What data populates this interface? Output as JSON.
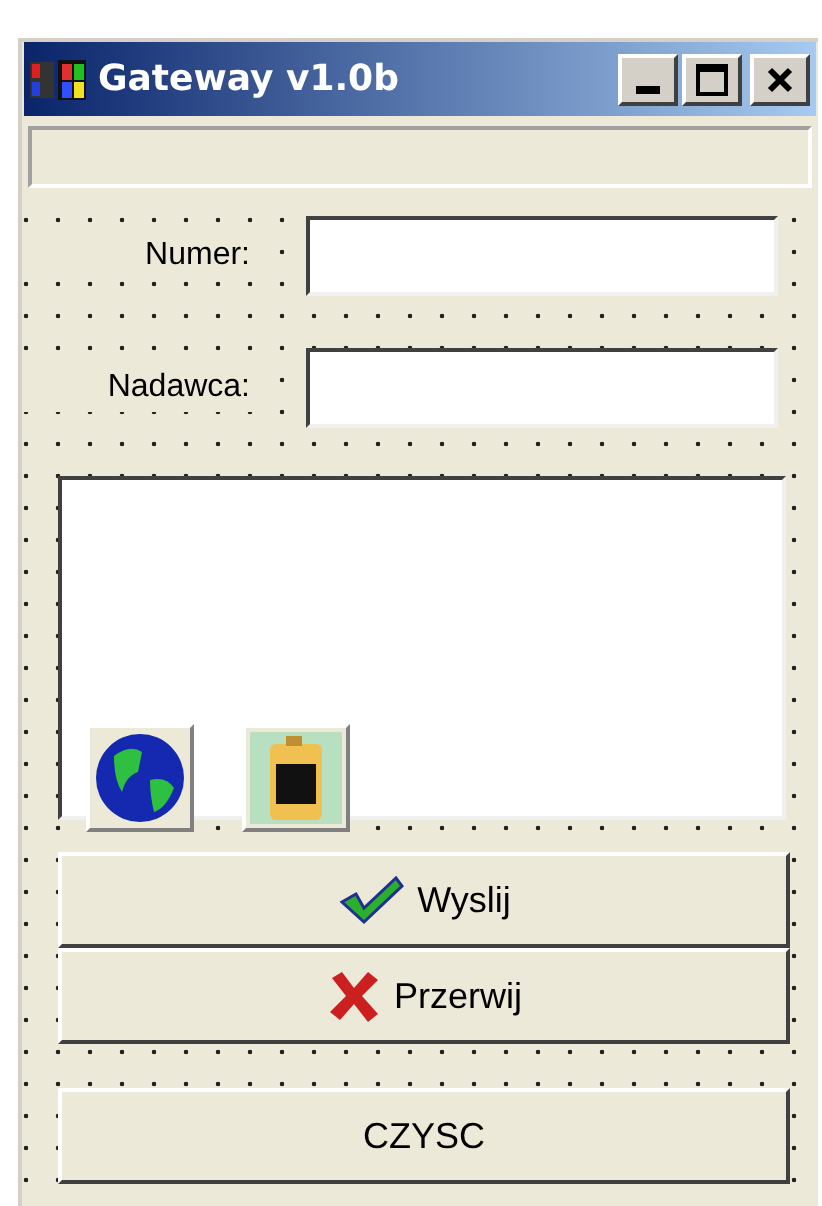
{
  "window": {
    "title": "Gateway v1.0b"
  },
  "fields": [
    {
      "label": "Numer:"
    },
    {
      "label": "Nadawca:"
    }
  ],
  "buttons": [
    {
      "label": "Wyslij",
      "kind": "check"
    },
    {
      "label": "Przerwij",
      "kind": "cross"
    },
    {
      "label": "CZYSC",
      "kind": "plain"
    }
  ]
}
